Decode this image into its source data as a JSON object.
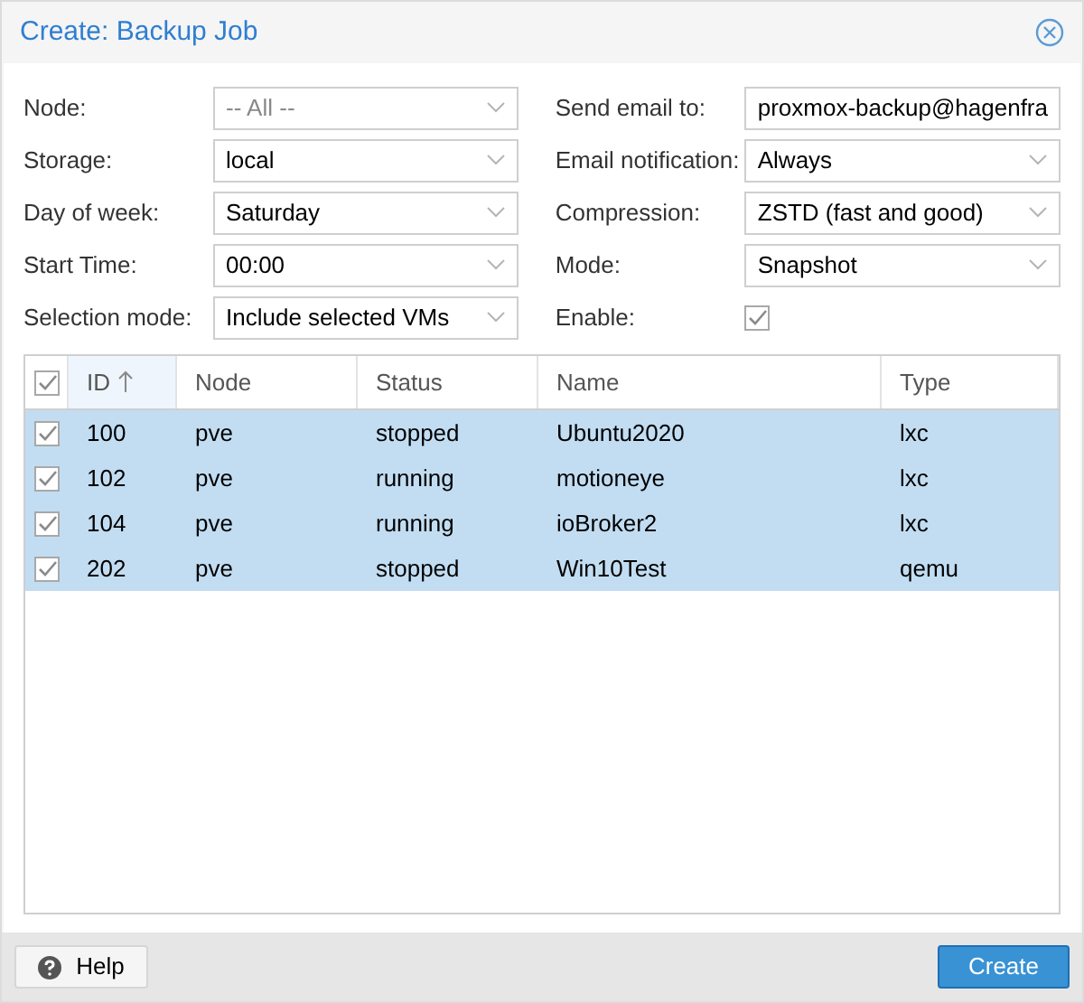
{
  "window": {
    "title": "Create: Backup Job"
  },
  "left_fields": [
    {
      "label": "Node:",
      "kind": "select",
      "placeholder": "-- All --"
    },
    {
      "label": "Storage:",
      "kind": "select",
      "value": "local"
    },
    {
      "label": "Day of week:",
      "kind": "select",
      "value": "Saturday"
    },
    {
      "label": "Start Time:",
      "kind": "select",
      "value": "00:00"
    },
    {
      "label": "Selection mode:",
      "kind": "select",
      "value": "Include selected VMs"
    }
  ],
  "right_fields": [
    {
      "label": "Send email to:",
      "kind": "text",
      "value": "proxmox-backup@hagenfra"
    },
    {
      "label": "Email notification:",
      "kind": "select",
      "value": "Always"
    },
    {
      "label": "Compression:",
      "kind": "select",
      "value": "ZSTD (fast and good)"
    },
    {
      "label": "Mode:",
      "kind": "select",
      "value": "Snapshot"
    },
    {
      "label": "Enable:",
      "kind": "checkbox",
      "checked": true
    }
  ],
  "table": {
    "all_checked": true,
    "columns": [
      {
        "label": "ID",
        "sorted": true
      },
      {
        "label": "Node",
        "sorted": false
      },
      {
        "label": "Status",
        "sorted": false
      },
      {
        "label": "Name",
        "sorted": false
      },
      {
        "label": "Type",
        "sorted": false
      }
    ],
    "rows": [
      {
        "selected": true,
        "cells": [
          "100",
          "pve",
          "stopped",
          "Ubuntu2020",
          "lxc"
        ]
      },
      {
        "selected": true,
        "cells": [
          "102",
          "pve",
          "running",
          "motioneye",
          "lxc"
        ]
      },
      {
        "selected": true,
        "cells": [
          "104",
          "pve",
          "running",
          "ioBroker2",
          "lxc"
        ]
      },
      {
        "selected": true,
        "cells": [
          "202",
          "pve",
          "stopped",
          "Win10Test",
          "qemu"
        ]
      }
    ]
  },
  "buttons": {
    "help": "Help",
    "create": "Create"
  }
}
